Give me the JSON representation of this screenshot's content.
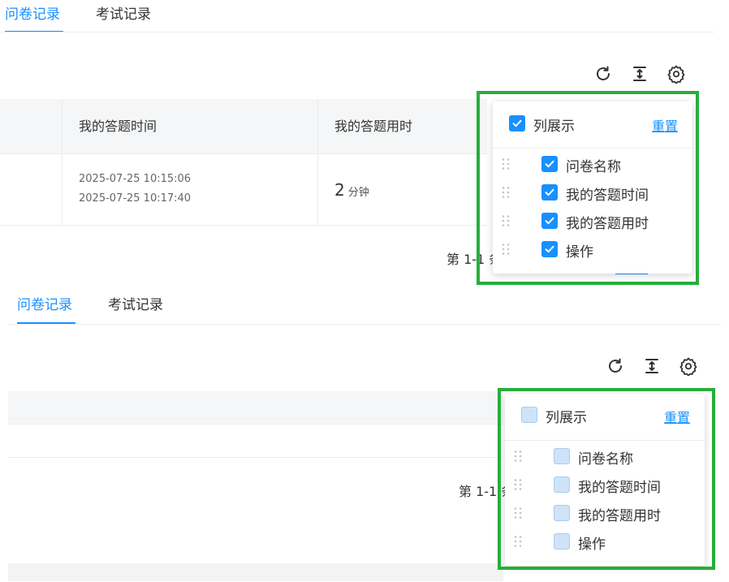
{
  "tabs": [
    {
      "label": "问卷记录"
    },
    {
      "label": "考试记录"
    }
  ],
  "toolbar": {
    "refresh_icon": "refresh-icon",
    "density_icon": "column-height-icon",
    "settings_icon": "gear-icon"
  },
  "table": {
    "columns": [
      "我的答题时间",
      "我的答题用时"
    ],
    "rows": [
      {
        "start_time": "2025-07-25 10:15:06",
        "end_time": "2025-07-25 10:17:40",
        "duration_value": "2",
        "duration_unit": "分钟"
      }
    ]
  },
  "pagination": {
    "total_text_top": "第 1-1 条",
    "total_text_bottom": "第 1-1 条"
  },
  "column_settings": {
    "title": "列展示",
    "reset_label": "重置",
    "items": [
      {
        "label": "问卷名称"
      },
      {
        "label": "我的答题时间"
      },
      {
        "label": "我的答题用时"
      },
      {
        "label": "操作"
      }
    ]
  },
  "states": {
    "top_all_checked": true,
    "bottom_all_checked": false
  },
  "colors": {
    "accent": "#1890ff",
    "highlight_frame": "#27ae3a",
    "unchecked_fill": "#cfe3f8"
  }
}
